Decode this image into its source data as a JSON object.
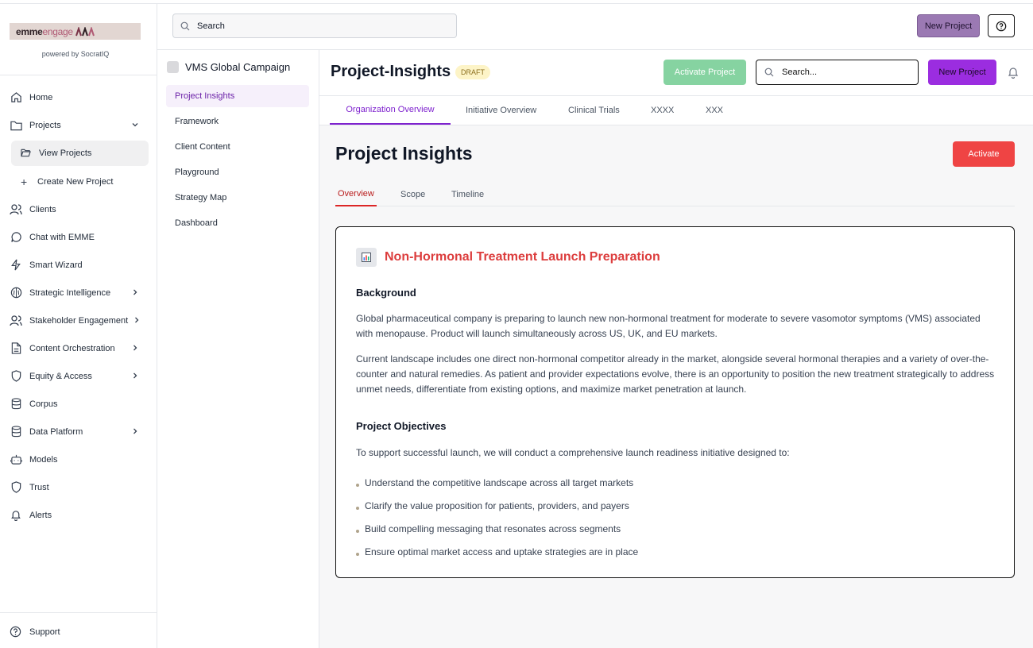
{
  "app": {
    "logo_main": "emme",
    "logo_accent": "engage",
    "powered_by": "powered by SocratIQ"
  },
  "sidebar": {
    "items": [
      {
        "label": "Home",
        "icon": "home-icon"
      },
      {
        "label": "Projects",
        "icon": "folder-icon",
        "expanded": true
      },
      {
        "label": "View Projects",
        "icon": "folder-open-icon",
        "sub": true,
        "active": true
      },
      {
        "label": "Create New Project",
        "icon": "plus-icon",
        "sub": true
      },
      {
        "label": "Clients",
        "icon": "users-icon"
      },
      {
        "label": "Chat with EMME",
        "icon": "chat-icon"
      },
      {
        "label": "Smart Wizard",
        "icon": "bolt-icon"
      },
      {
        "label": "Strategic Intelligence",
        "icon": "brain-icon",
        "has_children": true
      },
      {
        "label": "Stakeholder Engagement",
        "icon": "users-icon",
        "has_children": true
      },
      {
        "label": "Content Orchestration",
        "icon": "document-icon",
        "has_children": true
      },
      {
        "label": "Equity & Access",
        "icon": "shield-icon",
        "has_children": true
      },
      {
        "label": "Corpus",
        "icon": "database-icon"
      },
      {
        "label": "Data Platform",
        "icon": "database-icon",
        "has_children": true
      },
      {
        "label": "Models",
        "icon": "robot-icon"
      },
      {
        "label": "Trust",
        "icon": "shield-icon"
      },
      {
        "label": "Alerts",
        "icon": "bell-icon"
      }
    ],
    "support_label": "Support"
  },
  "topbar": {
    "search_placeholder": "Search",
    "new_project_label": "New Project",
    "help_icon": "help-circle-icon"
  },
  "project_sidebar": {
    "project_name": "VMS Global Campaign",
    "items": [
      "Project Insights",
      "Framework",
      "Client Content",
      "Playground",
      "Strategy Map",
      "Dashboard"
    ],
    "active": "Project Insights"
  },
  "project_header": {
    "title": "Project-Insights",
    "status_badge": "DRAFT",
    "activate_project_label": "Activate Project",
    "search_placeholder": "Search...",
    "new_project_label": "New Project"
  },
  "tabs": [
    "Organization Overview",
    "Initiative Overview",
    "Clinical Trials",
    "XXXX",
    "XXX"
  ],
  "main": {
    "title": "Project Insights",
    "activate_label": "Activate",
    "subtabs": [
      "Overview",
      "Scope",
      "Timeline"
    ],
    "card": {
      "title": "Non-Hormonal Treatment Launch Preparation",
      "background_heading": "Background",
      "background_p1": "Global pharmaceutical company is preparing to launch new non-hormonal treatment for moderate to severe vasomotor symptoms (VMS) associated with menopause. Product will launch simultaneously across US, UK, and EU markets.",
      "background_p2": "Current landscape includes one direct non-hormonal competitor already in the market, alongside several hormonal therapies and a variety of over-the-counter and natural remedies. As patient and provider expectations evolve, there is an opportunity to position the new treatment strategically to address unmet needs, differentiate from existing options, and maximize market penetration at launch.",
      "objectives_heading": "Project Objectives",
      "objectives_intro": "To support successful launch, we will conduct a comprehensive launch readiness initiative designed to:",
      "objectives": [
        "Understand the competitive landscape across all target markets",
        "Clarify the value proposition for patients, providers, and payers",
        "Build compelling messaging that resonates across segments",
        "Ensure optimal market access and uptake strategies are in place"
      ]
    }
  },
  "colors": {
    "brand_purple": "#9b2de0",
    "activate_red": "#ef4444",
    "activate_project_green": "#86d3a1",
    "draft_badge": "#fdf4c7",
    "card_title_red": "#dc3d3d"
  }
}
